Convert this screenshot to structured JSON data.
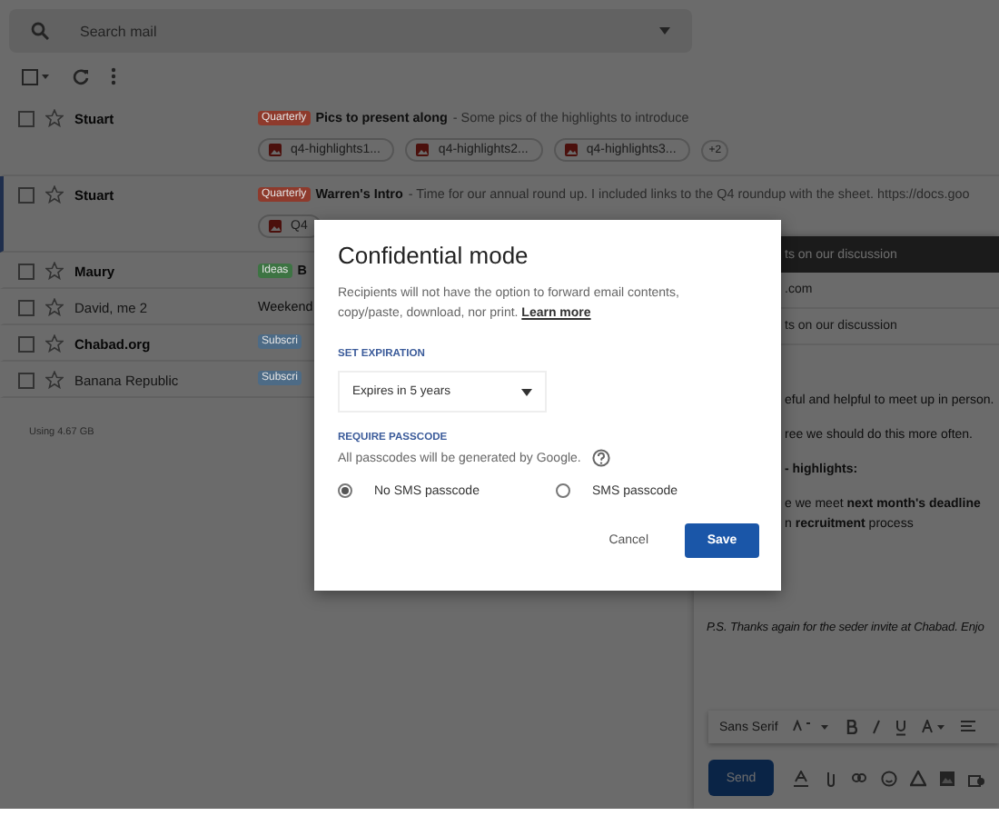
{
  "search": {
    "placeholder": "Search mail"
  },
  "mail_list": {
    "rows": [
      {
        "sender": "Stuart",
        "unread": true,
        "focused": false,
        "tag": {
          "label": "Quarterly",
          "color": "#8e3a2c"
        },
        "subject": "Pics to present along",
        "snippet": " - Some pics of the highlights to introduce",
        "attachments": [
          "q4-highlights1...",
          "q4-highlights2...",
          "q4-highlights3..."
        ],
        "more": "+2"
      },
      {
        "sender": "Stuart",
        "unread": true,
        "focused": true,
        "tag": {
          "label": "Quarterly",
          "color": "#8e3a2c"
        },
        "subject": "Warren's Intro",
        "snippet": " - Time for our annual round up. I included links to the Q4 roundup with the sheet. https://docs.goo",
        "attachments": [
          "Q4"
        ]
      },
      {
        "sender": "Maury",
        "unread": true,
        "focused": false,
        "tag": {
          "label": "Ideas",
          "color": "#3d7443"
        },
        "subject": "B"
      },
      {
        "sender": "David, me 2",
        "unread": false,
        "focused": false,
        "subject": "Weekend"
      },
      {
        "sender": "Chabad.org",
        "unread": true,
        "focused": false,
        "tag": {
          "label": "Subscri",
          "color": "#4d6b86"
        }
      },
      {
        "sender": "Banana Republic",
        "unread": false,
        "focused": false,
        "tag": {
          "label": "Subscri",
          "color": "#4d6b86"
        }
      }
    ]
  },
  "storage": "Using 4.67 GB",
  "compose": {
    "header": "ts on our discussion",
    "to": ".com",
    "subject": "ts on our discussion",
    "lines": [
      "eful and helpful to meet up in person.",
      "ree we should do this more often.",
      "**- highlights:**",
      "e we meet **next month's deadline**",
      "n **recruitment** process"
    ],
    "postscript": "P.S. Thanks again for the seder invite at Chabad. Enjo",
    "font": "Sans Serif",
    "send": "Send"
  },
  "dialog": {
    "title": "Confidential mode",
    "description": "Recipients will not have the option to forward email contents, copy/paste, download, nor print.",
    "link": "Learn more",
    "expiration_label": "SET EXPIRATION",
    "expiration": "Expires in 5 years",
    "passcode_label": "REQUIRE PASSCODE",
    "passcode_note": "All passcodes will be generated by Google.",
    "options": [
      {
        "label": "No SMS passcode",
        "selected": true
      },
      {
        "label": "SMS passcode",
        "selected": false
      }
    ],
    "buttons": {
      "cancel": "Cancel",
      "save": "Save"
    }
  }
}
